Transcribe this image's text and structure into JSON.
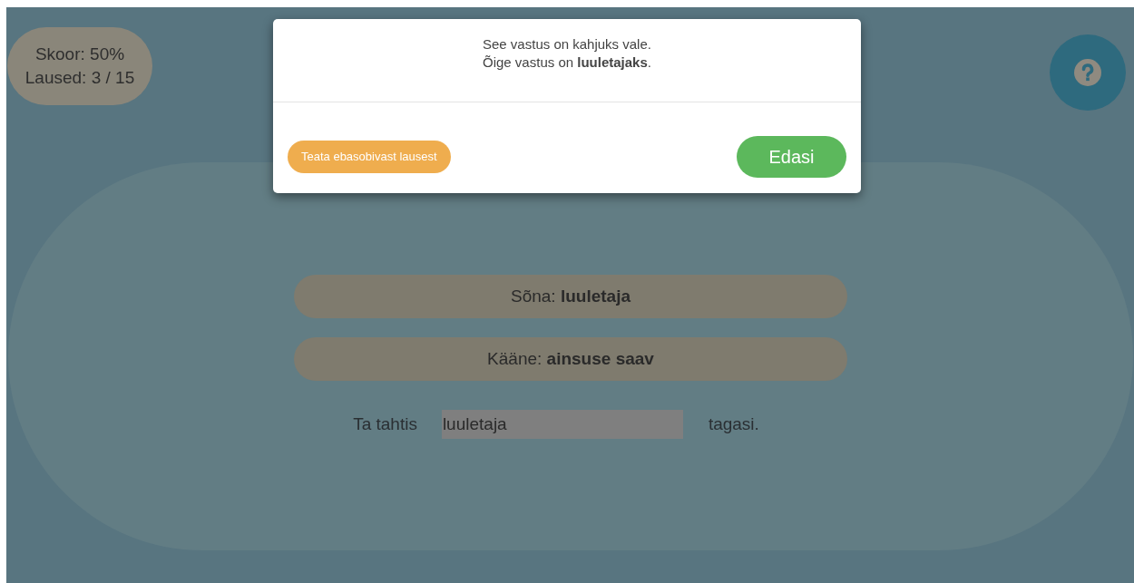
{
  "stats": {
    "score": "Skoor: 50%",
    "sentences": "Laused: 3 / 15"
  },
  "task": {
    "word": "Sõna: **luuletaja**",
    "case": "Kääne: **ainsuse saav**"
  },
  "sentence": {
    "before": "Ta tahtis",
    "answer": "luuletaja",
    "after": "tagasi."
  },
  "dialog": {
    "message": "See vastus on kahjuks vale.",
    "correction": "Õige vastus on **luuletajaks**.",
    "report_button": "Teata ebasobivast lausest",
    "next_button": "Edasi"
  }
}
